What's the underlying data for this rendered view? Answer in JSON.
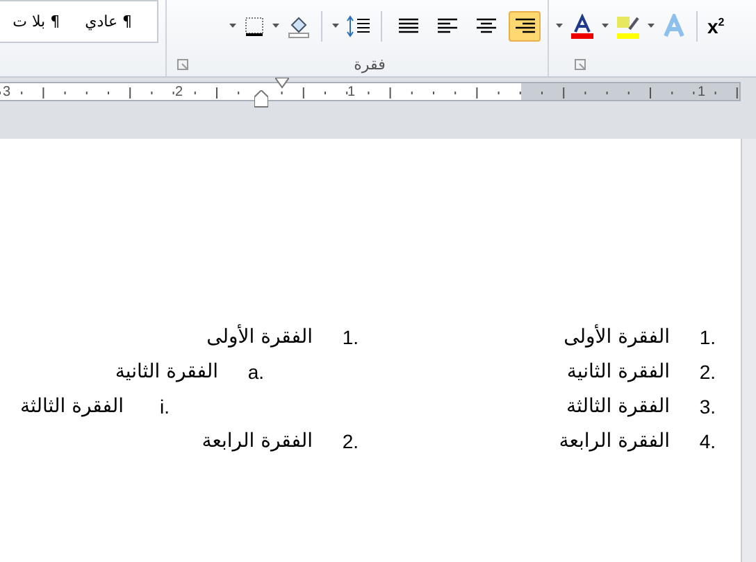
{
  "ribbon": {
    "styles": [
      {
        "label": "¶ عادي"
      },
      {
        "label": "¶ بلا ت"
      }
    ],
    "paragraph_group": {
      "label": "فقرة",
      "alignment": [
        {
          "kind": "justify",
          "selected": false
        },
        {
          "kind": "left",
          "selected": false
        },
        {
          "kind": "center",
          "selected": false
        },
        {
          "kind": "right",
          "selected": true
        }
      ]
    },
    "font_group": {
      "superscript": "x$^{2}$"
    }
  },
  "ruler": {
    "labels": [
      "1",
      "1",
      "2",
      "3"
    ]
  },
  "document": {
    "lists": [
      {
        "items": [
          {
            "number": "1.",
            "text": "الفقرة الأولى"
          },
          {
            "number": "2.",
            "text": "الفقرة الثانية"
          },
          {
            "number": "3.",
            "text": "الفقرة الثالثة"
          },
          {
            "number": "4.",
            "text": "الفقرة الرابعة"
          }
        ]
      },
      {
        "items": [
          {
            "number": "1.",
            "text": "الفقرة الأولى",
            "children": [
              {
                "number": "a.",
                "text": "الفقرة الثانية",
                "children": [
                  {
                    "number": "i.",
                    "text": "الفقرة الثالثة"
                  }
                ]
              }
            ]
          },
          {
            "number": "2.",
            "text": "الفقرة الرابعة"
          }
        ]
      }
    ]
  }
}
